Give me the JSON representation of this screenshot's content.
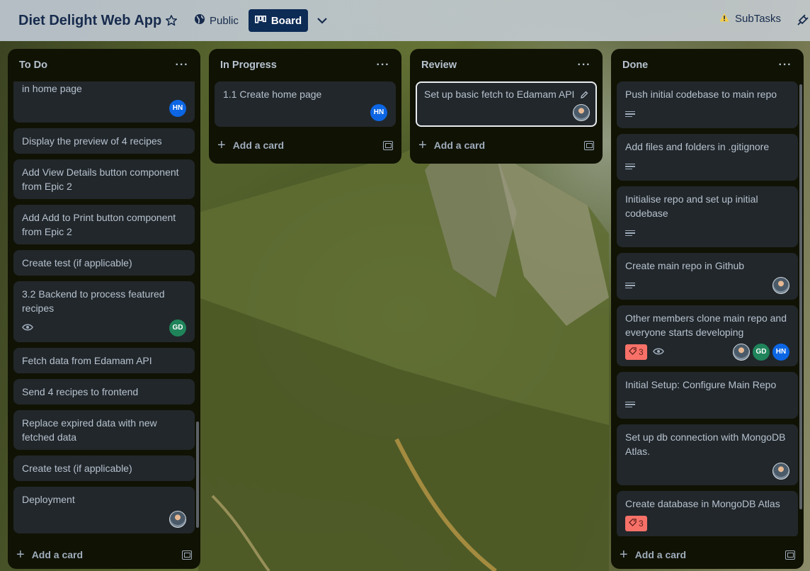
{
  "header": {
    "board_title": "Diet Delight Web App",
    "visibility": "Public",
    "view_label": "Board",
    "subtasks_label": "SubTasks"
  },
  "colors": {
    "board_button": "#0c2b55",
    "list_bg": "#101204",
    "card_bg": "#22272b",
    "avatar_hn": "#0c66e4",
    "avatar_gd": "#1f845a",
    "badge_red": "#f87168"
  },
  "lists": [
    {
      "title": "To Do",
      "add_label": "Add a card",
      "cards": [
        {
          "title": "in home page",
          "avatars": [
            "HN"
          ]
        },
        {
          "title": "Display the preview of 4 recipes"
        },
        {
          "title": "Add View Details button component from Epic 2"
        },
        {
          "title": "Add Add to Print button component from Epic 2"
        },
        {
          "title": "Create test (if applicable)"
        },
        {
          "title": "3.2 Backend to process featured recipes",
          "watch": true,
          "avatars": [
            "GD"
          ]
        },
        {
          "title": "Fetch data from Edamam API"
        },
        {
          "title": "Send 4 recipes to frontend"
        },
        {
          "title": "Replace expired data with new fetched data"
        },
        {
          "title": "Create test (if applicable)"
        },
        {
          "title": "Deployment",
          "avatars": [
            "photo"
          ]
        }
      ]
    },
    {
      "title": "In Progress",
      "add_label": "Add a card",
      "cards": [
        {
          "title": "1.1 Create home page",
          "avatars": [
            "HN"
          ]
        }
      ]
    },
    {
      "title": "Review",
      "add_label": "Add a card",
      "cards": [
        {
          "title": "Set up basic fetch to Edamam API",
          "avatars": [
            "photo"
          ],
          "selected": true
        }
      ]
    },
    {
      "title": "Done",
      "add_label": "Add a card",
      "cards": [
        {
          "title": "Push initial codebase to main repo",
          "description": true
        },
        {
          "title": "Add files and folders in .gitignore",
          "description": true
        },
        {
          "title": "Initialise repo and set up initial codebase",
          "description": true
        },
        {
          "title": "Create main repo in Github",
          "description": true,
          "avatars": [
            "photo"
          ]
        },
        {
          "title": "Other members clone main repo and everyone starts developing",
          "badge": "3",
          "watch": true,
          "avatars": [
            "photo",
            "GD",
            "HN"
          ]
        },
        {
          "title": "Initial Setup: Configure Main Repo",
          "description": true
        },
        {
          "title": "Set up db connection with MongoDB Atlas.",
          "avatars": [
            "photo"
          ]
        },
        {
          "title": "Create database in MongoDB Atlas",
          "badge": "3"
        }
      ]
    }
  ]
}
